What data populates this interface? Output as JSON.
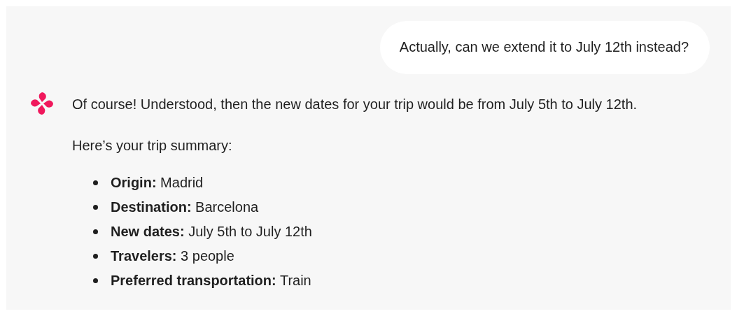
{
  "user_message": "Actually, can we extend it to July 12th instead?",
  "assistant_message": {
    "paragraphs": [
      "Of course! Understood, then the new dates for your trip would be from July 5th to July 12th.",
      "Here’s your trip summary:"
    ],
    "summary": [
      {
        "label": "Origin:",
        "value": "Madrid"
      },
      {
        "label": "Destination:",
        "value": "Barcelona"
      },
      {
        "label": "New dates:",
        "value": "July 5th to July 12th"
      },
      {
        "label": "Travelers:",
        "value": "3 people"
      },
      {
        "label": "Preferred transportation:",
        "value": "Train"
      }
    ]
  }
}
